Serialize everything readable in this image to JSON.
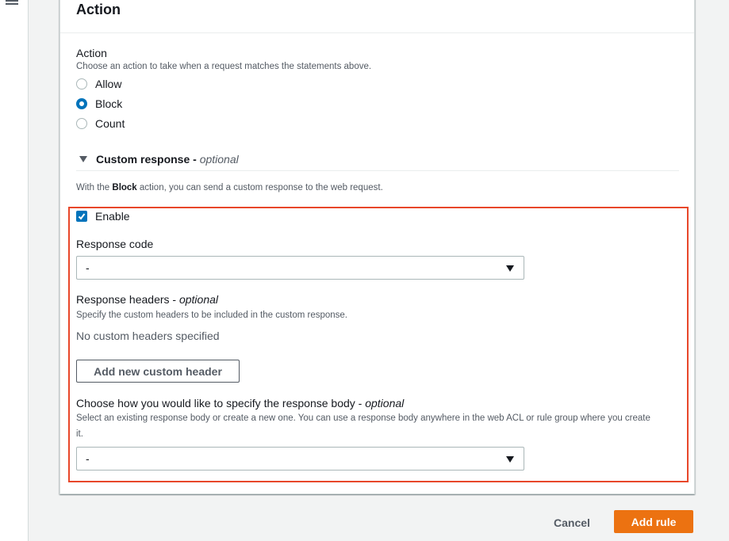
{
  "panel": {
    "title": "Action"
  },
  "action": {
    "label": "Action",
    "description": "Choose an action to take when a request matches the statements above.",
    "options": [
      {
        "label": "Allow",
        "checked": false
      },
      {
        "label": "Block",
        "checked": true
      },
      {
        "label": "Count",
        "checked": false
      }
    ]
  },
  "custom_response": {
    "title": "Custom response - ",
    "optional": "optional",
    "intro_prefix": "With the ",
    "intro_bold": "Block",
    "intro_suffix": " action, you can send a custom response to the web request.",
    "enable_label": "Enable",
    "enable_checked": true,
    "response_code_label": "Response code",
    "response_code_value": "-",
    "headers_label": "Response headers - ",
    "headers_optional": "optional",
    "headers_description": "Specify the custom headers to be included in the custom response.",
    "headers_empty": "No custom headers specified",
    "add_header_button": "Add new custom header",
    "body_label": "Choose how you would like to specify the response body - ",
    "body_optional": "optional",
    "body_description_line1": "Select an existing response body or create a new one. You can use a response body anywhere in the web ACL or rule group where you create",
    "body_description_line2": "it.",
    "body_value": "-"
  },
  "footer": {
    "cancel_label": "Cancel",
    "add_rule_label": "Add rule"
  },
  "colors": {
    "accent": "#0073bb",
    "primary_button": "#ec7211",
    "highlight": "#e8472a"
  }
}
